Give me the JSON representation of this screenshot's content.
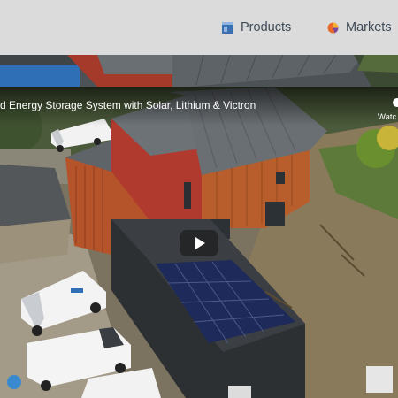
{
  "nav": {
    "items": [
      {
        "label": "Products",
        "icon": "products-icon"
      },
      {
        "label": "Markets",
        "icon": "markets-icon"
      }
    ]
  },
  "colors": {
    "nav_background": "#dbdbdb",
    "nav_text": "#3d4a57",
    "products_icon": "#3a6fb0",
    "markets_icon": "#e8692a"
  },
  "video": {
    "title": "d Energy Storage System with Solar, Lithium & Victron",
    "watch_label": "Watc",
    "play_icon": "play-icon"
  }
}
